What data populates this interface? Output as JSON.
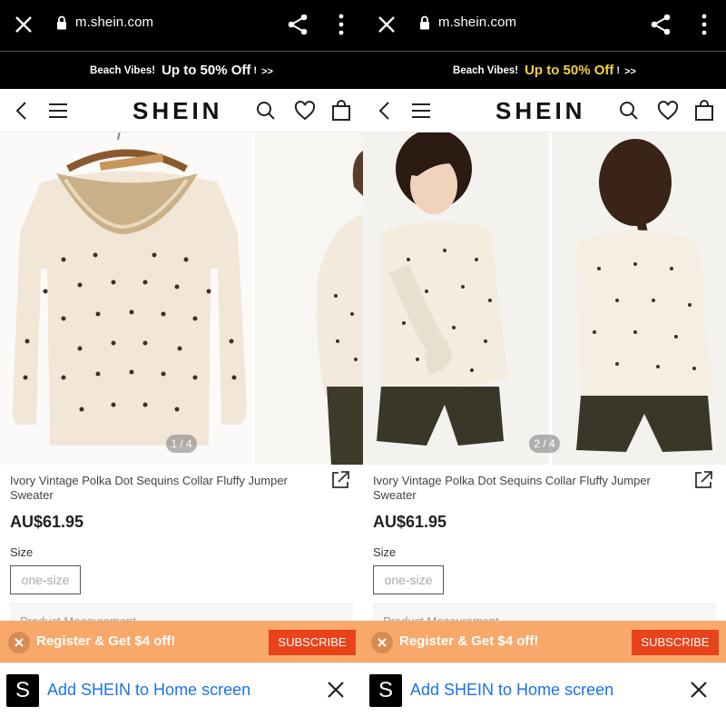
{
  "panes": [
    {
      "url": "m.shein.com",
      "promo": {
        "lead": "Beach Vibes!",
        "offer": "Up to 50% Off",
        "bang": "!",
        "arrows": ">>",
        "offer_color": "#ffffff"
      },
      "logo": "SHEIN",
      "counter": "1 / 4",
      "title": "Ivory Vintage Polka Dot Sequins Collar Fluffy Jumper Sweater",
      "price": "AU$61.95",
      "size_label": "Size",
      "size_option": "one-size",
      "measure": "Product Measurement",
      "subscribe_text": "Register & Get $4 off!",
      "subscribe_button": "SUBSCRIBE",
      "a2hs_icon": "S",
      "a2hs_text": "Add SHEIN to Home screen"
    },
    {
      "url": "m.shein.com",
      "promo": {
        "lead": "Beach Vibes!",
        "offer": "Up to 50% Off",
        "bang": "!",
        "arrows": ">>",
        "offer_color": "#f6d23b"
      },
      "logo": "SHEIN",
      "counter": "2 / 4",
      "title": "Ivory Vintage Polka Dot Sequins Collar Fluffy Jumper Sweater",
      "price": "AU$61.95",
      "size_label": "Size",
      "size_option": "one-size",
      "measure": "Product Measurement",
      "subscribe_text": "Register & Get $4 off!",
      "subscribe_button": "SUBSCRIBE",
      "a2hs_icon": "S",
      "a2hs_text": "Add SHEIN to Home screen"
    }
  ],
  "icons": {
    "close": "close-icon",
    "lock": "lock-icon",
    "share": "share-icon",
    "more": "more-vertical-icon",
    "back": "chevron-left-icon",
    "menu": "hamburger-menu-icon",
    "search": "search-icon",
    "wishlist": "heart-icon",
    "bag": "shopping-bag-icon",
    "external": "external-link-icon"
  },
  "colors": {
    "subscribe_bar": "#f7a86a",
    "subscribe_button": "#e8431a",
    "a2hs_link": "#1a73e8"
  }
}
